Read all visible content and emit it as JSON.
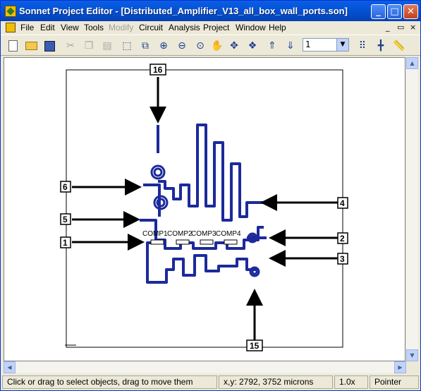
{
  "window": {
    "title": "Sonnet Project Editor - [Distributed_Amplifier_V13_all_box_wall_ports.son]",
    "minimize": "_",
    "maximize": "□",
    "close": "✕"
  },
  "menubar": {
    "items": [
      "File",
      "Edit",
      "View",
      "Tools",
      "Modify",
      "Circuit",
      "Analysis",
      "Project",
      "Window",
      "Help"
    ],
    "disabled": [
      "Modify"
    ],
    "mdi_minimize": "_",
    "mdi_restore": "▭",
    "mdi_close": "×"
  },
  "toolbar": {
    "level_value": "1",
    "icons": [
      "new-file-icon",
      "open-folder-icon",
      "save-icon",
      "cut-icon",
      "copy-icon",
      "paste-icon",
      "select-icon",
      "zoom-box-icon",
      "zoom-in-icon",
      "zoom-out-icon",
      "zoom-fit-icon",
      "pan-icon",
      "rotate-icon",
      "3d-view-icon",
      "level-up-icon",
      "level-down-icon",
      "grid-icon",
      "snap-icon",
      "ruler-icon"
    ]
  },
  "canvas": {
    "ports": {
      "p16": "16",
      "p6": "6",
      "p5": "5",
      "p1": "1",
      "p4": "4",
      "p2": "2",
      "p3": "3",
      "p15": "15"
    },
    "components": {
      "comp1": "COMP1",
      "comp2": "COMP2",
      "comp3": "COMP3",
      "comp4": "COMP4"
    }
  },
  "statusbar": {
    "message": "Click or drag to select objects, drag to move them",
    "coordinates": "x,y:  2792,  3752 microns",
    "zoom": "1.0x",
    "mode": "Pointer"
  },
  "colors": {
    "title_bar": "#0454d9",
    "circuit_metal": "#1c2a9b",
    "canvas_bg": "#ffffff"
  }
}
